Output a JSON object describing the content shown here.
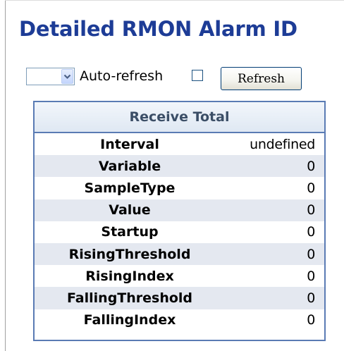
{
  "page": {
    "title": "Detailed RMON Alarm  ID"
  },
  "controls": {
    "select_value": "",
    "autorefresh_label": "Auto-refresh",
    "autorefresh_checked": false,
    "refresh_label": "Refresh"
  },
  "panel": {
    "header": "Receive Total",
    "rows": [
      {
        "label": "Interval",
        "value": "undefined"
      },
      {
        "label": "Variable",
        "value": "0"
      },
      {
        "label": "SampleType",
        "value": "0"
      },
      {
        "label": "Value",
        "value": "0"
      },
      {
        "label": "Startup",
        "value": "0"
      },
      {
        "label": "RisingThreshold",
        "value": "0"
      },
      {
        "label": "RisingIndex",
        "value": "0"
      },
      {
        "label": "FallingThreshold",
        "value": "0"
      },
      {
        "label": "FallingIndex",
        "value": "0"
      }
    ]
  },
  "icons": {
    "dropdown": "chevron-down-icon"
  },
  "colors": {
    "title": "#1d3c96",
    "panel_border": "#5a7bb4",
    "alt_row": "#e4e8f0",
    "header_text": "#3b4e66"
  }
}
